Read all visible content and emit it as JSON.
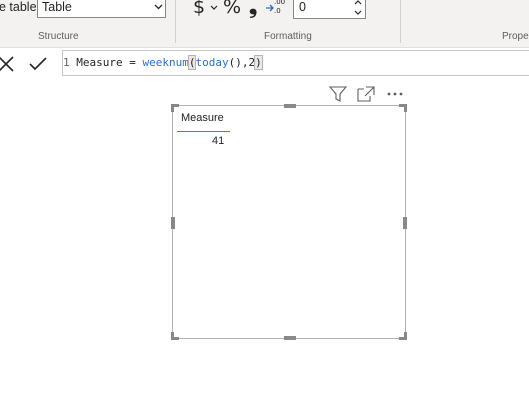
{
  "ribbon": {
    "structure": {
      "row_label": "e table",
      "dropdown_value": "Table",
      "group_label": "Structure"
    },
    "formatting": {
      "currency_symbol": "$",
      "percent_symbol": "%",
      "comma_symbol": "❟",
      "number_value": "0",
      "group_label": "Formatting"
    },
    "properties": {
      "group_label": "Prope"
    }
  },
  "formula": {
    "line_number": "1",
    "text_prefix": " Measure = ",
    "func_weeknum": "weeknum",
    "open_paren": "(",
    "func_today": "today",
    "text_mid": "(),2",
    "close_paren": ")"
  },
  "visual": {
    "column_header": "Measure",
    "value": "41"
  },
  "accent_color": "#118dff"
}
